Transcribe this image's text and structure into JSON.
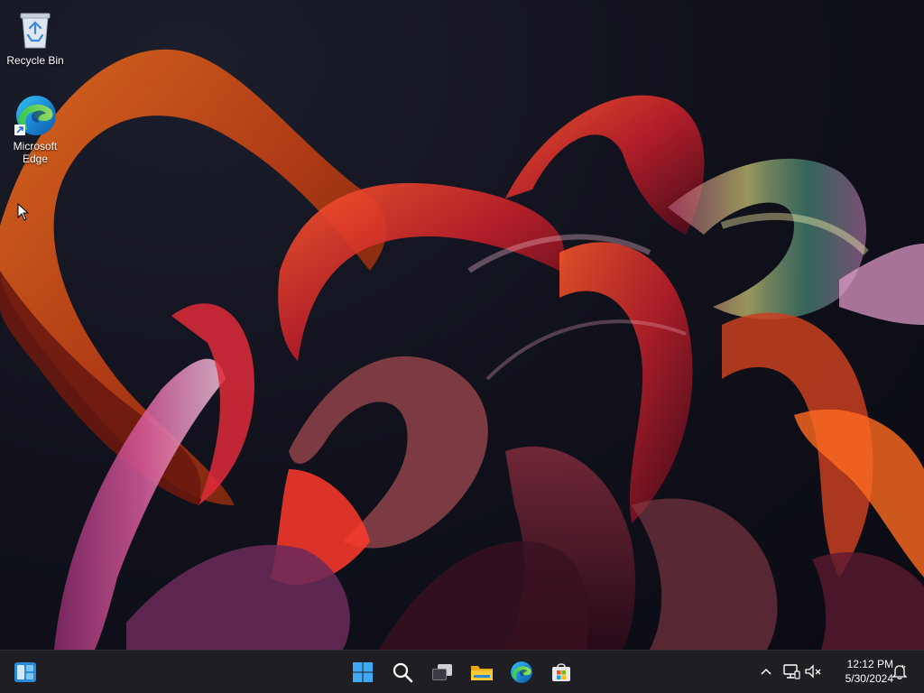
{
  "desktop": {
    "icons": [
      {
        "label": "Recycle Bin",
        "icon": "recycle-bin-icon"
      },
      {
        "label": "Microsoft\nEdge",
        "label_line1": "Microsoft",
        "label_line2": "Edge",
        "icon": "edge-icon"
      }
    ]
  },
  "taskbar": {
    "left": [
      {
        "icon": "widgets-icon"
      }
    ],
    "center": [
      {
        "icon": "start-icon"
      },
      {
        "icon": "search-icon"
      },
      {
        "icon": "task-view-icon"
      },
      {
        "icon": "file-explorer-icon"
      },
      {
        "icon": "edge-icon"
      },
      {
        "icon": "microsoft-store-icon"
      }
    ],
    "tray": {
      "icons": [
        "show-hidden-icons-chevron-icon",
        "network-icon",
        "volume-muted-icon"
      ],
      "time": "12:12 PM",
      "date": "5/30/2024",
      "notification_icon": "notification-bell-icon"
    }
  },
  "colors": {
    "taskbar": "#1f1f23",
    "wallpaper_bg": "#10111b",
    "ribbon_orange": "#d8561b",
    "ribbon_red": "#c21f2a",
    "ribbon_pink": "#d85a9c",
    "accent_blue": "#2aa0f0"
  }
}
